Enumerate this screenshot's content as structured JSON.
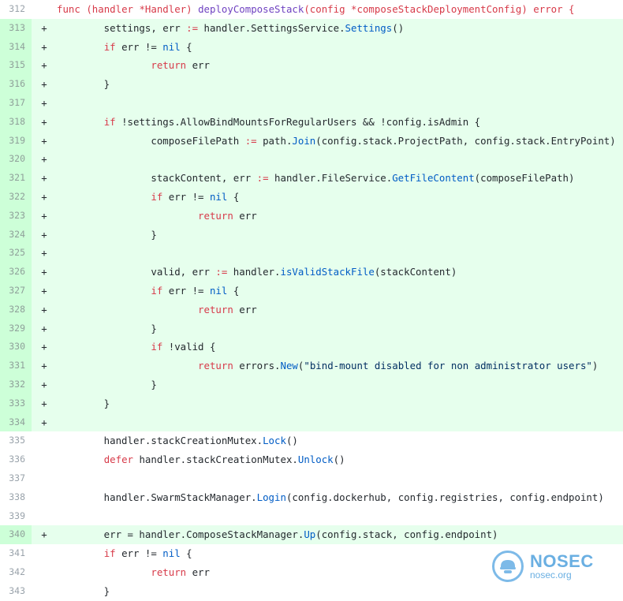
{
  "diff": {
    "lines": [
      {
        "num": "312",
        "type": "context",
        "sign": "",
        "tokens": [
          {
            "t": "kw",
            "v": "func "
          },
          {
            "t": "kw",
            "v": "(handler *Handler) "
          },
          {
            "t": "fn",
            "v": "deployComposeStack"
          },
          {
            "t": "kw",
            "v": "(config *composeStackDeploymentConfig) error {"
          }
        ]
      },
      {
        "num": "313",
        "type": "added",
        "sign": "+",
        "tokens": [
          {
            "t": "plain",
            "v": "        settings, err "
          },
          {
            "t": "kw",
            "v": ":="
          },
          {
            "t": "plain",
            "v": " handler.SettingsService."
          },
          {
            "t": "call",
            "v": "Settings"
          },
          {
            "t": "plain",
            "v": "()"
          }
        ]
      },
      {
        "num": "314",
        "type": "added",
        "sign": "+",
        "tokens": [
          {
            "t": "plain",
            "v": "        "
          },
          {
            "t": "kw",
            "v": "if"
          },
          {
            "t": "plain",
            "v": " err != "
          },
          {
            "t": "call",
            "v": "nil"
          },
          {
            "t": "plain",
            "v": " {"
          }
        ]
      },
      {
        "num": "315",
        "type": "added",
        "sign": "+",
        "tokens": [
          {
            "t": "plain",
            "v": "                "
          },
          {
            "t": "kw",
            "v": "return"
          },
          {
            "t": "plain",
            "v": " err"
          }
        ]
      },
      {
        "num": "316",
        "type": "added",
        "sign": "+",
        "tokens": [
          {
            "t": "plain",
            "v": "        }"
          }
        ]
      },
      {
        "num": "317",
        "type": "added",
        "sign": "+",
        "tokens": []
      },
      {
        "num": "318",
        "type": "added",
        "sign": "+",
        "tokens": [
          {
            "t": "plain",
            "v": "        "
          },
          {
            "t": "kw",
            "v": "if"
          },
          {
            "t": "plain",
            "v": " !settings.AllowBindMountsForRegularUsers && !config.isAdmin {"
          }
        ]
      },
      {
        "num": "319",
        "type": "added",
        "sign": "+",
        "tokens": [
          {
            "t": "plain",
            "v": "                composeFilePath "
          },
          {
            "t": "kw",
            "v": ":="
          },
          {
            "t": "plain",
            "v": " path."
          },
          {
            "t": "call",
            "v": "Join"
          },
          {
            "t": "plain",
            "v": "(config.stack.ProjectPath, config.stack.EntryPoint)"
          }
        ]
      },
      {
        "num": "320",
        "type": "added",
        "sign": "+",
        "tokens": []
      },
      {
        "num": "321",
        "type": "added",
        "sign": "+",
        "tokens": [
          {
            "t": "plain",
            "v": "                stackContent, err "
          },
          {
            "t": "kw",
            "v": ":="
          },
          {
            "t": "plain",
            "v": " handler.FileService."
          },
          {
            "t": "call",
            "v": "GetFileContent"
          },
          {
            "t": "plain",
            "v": "(composeFilePath)"
          }
        ]
      },
      {
        "num": "322",
        "type": "added",
        "sign": "+",
        "tokens": [
          {
            "t": "plain",
            "v": "                "
          },
          {
            "t": "kw",
            "v": "if"
          },
          {
            "t": "plain",
            "v": " err != "
          },
          {
            "t": "call",
            "v": "nil"
          },
          {
            "t": "plain",
            "v": " {"
          }
        ]
      },
      {
        "num": "323",
        "type": "added",
        "sign": "+",
        "tokens": [
          {
            "t": "plain",
            "v": "                        "
          },
          {
            "t": "kw",
            "v": "return"
          },
          {
            "t": "plain",
            "v": " err"
          }
        ]
      },
      {
        "num": "324",
        "type": "added",
        "sign": "+",
        "tokens": [
          {
            "t": "plain",
            "v": "                }"
          }
        ]
      },
      {
        "num": "325",
        "type": "added",
        "sign": "+",
        "tokens": []
      },
      {
        "num": "326",
        "type": "added",
        "sign": "+",
        "tokens": [
          {
            "t": "plain",
            "v": "                valid, err "
          },
          {
            "t": "kw",
            "v": ":="
          },
          {
            "t": "plain",
            "v": " handler."
          },
          {
            "t": "call",
            "v": "isValidStackFile"
          },
          {
            "t": "plain",
            "v": "(stackContent)"
          }
        ]
      },
      {
        "num": "327",
        "type": "added",
        "sign": "+",
        "tokens": [
          {
            "t": "plain",
            "v": "                "
          },
          {
            "t": "kw",
            "v": "if"
          },
          {
            "t": "plain",
            "v": " err != "
          },
          {
            "t": "call",
            "v": "nil"
          },
          {
            "t": "plain",
            "v": " {"
          }
        ]
      },
      {
        "num": "328",
        "type": "added",
        "sign": "+",
        "tokens": [
          {
            "t": "plain",
            "v": "                        "
          },
          {
            "t": "kw",
            "v": "return"
          },
          {
            "t": "plain",
            "v": " err"
          }
        ]
      },
      {
        "num": "329",
        "type": "added",
        "sign": "+",
        "tokens": [
          {
            "t": "plain",
            "v": "                }"
          }
        ]
      },
      {
        "num": "330",
        "type": "added",
        "sign": "+",
        "tokens": [
          {
            "t": "plain",
            "v": "                "
          },
          {
            "t": "kw",
            "v": "if"
          },
          {
            "t": "plain",
            "v": " !valid {"
          }
        ]
      },
      {
        "num": "331",
        "type": "added",
        "sign": "+",
        "tokens": [
          {
            "t": "plain",
            "v": "                        "
          },
          {
            "t": "kw",
            "v": "return"
          },
          {
            "t": "plain",
            "v": " errors."
          },
          {
            "t": "call",
            "v": "New"
          },
          {
            "t": "plain",
            "v": "("
          },
          {
            "t": "str",
            "v": "\"bind-mount disabled for non administrator users\""
          },
          {
            "t": "plain",
            "v": ")"
          }
        ]
      },
      {
        "num": "332",
        "type": "added",
        "sign": "+",
        "tokens": [
          {
            "t": "plain",
            "v": "                }"
          }
        ]
      },
      {
        "num": "333",
        "type": "added",
        "sign": "+",
        "tokens": [
          {
            "t": "plain",
            "v": "        }"
          }
        ]
      },
      {
        "num": "334",
        "type": "added",
        "sign": "+",
        "tokens": []
      },
      {
        "num": "335",
        "type": "context",
        "sign": "",
        "tokens": [
          {
            "t": "plain",
            "v": "        handler.stackCreationMutex."
          },
          {
            "t": "call",
            "v": "Lock"
          },
          {
            "t": "plain",
            "v": "()"
          }
        ]
      },
      {
        "num": "336",
        "type": "context",
        "sign": "",
        "tokens": [
          {
            "t": "plain",
            "v": "        "
          },
          {
            "t": "kw",
            "v": "defer"
          },
          {
            "t": "plain",
            "v": " handler.stackCreationMutex."
          },
          {
            "t": "call",
            "v": "Unlock"
          },
          {
            "t": "plain",
            "v": "()"
          }
        ]
      },
      {
        "num": "337",
        "type": "context",
        "sign": "",
        "tokens": []
      },
      {
        "num": "338",
        "type": "context",
        "sign": "",
        "tokens": [
          {
            "t": "plain",
            "v": "        handler.SwarmStackManager."
          },
          {
            "t": "call",
            "v": "Login"
          },
          {
            "t": "plain",
            "v": "(config.dockerhub, config.registries, config.endpoint)"
          }
        ]
      },
      {
        "num": "339",
        "type": "context",
        "sign": "",
        "tokens": []
      },
      {
        "num": "340",
        "type": "added",
        "sign": "+",
        "tokens": [
          {
            "t": "plain",
            "v": "        err = handler.ComposeStackManager."
          },
          {
            "t": "call",
            "v": "Up"
          },
          {
            "t": "plain",
            "v": "(config.stack, config.endpoint)"
          }
        ]
      },
      {
        "num": "341",
        "type": "context",
        "sign": "",
        "tokens": [
          {
            "t": "plain",
            "v": "        "
          },
          {
            "t": "kw",
            "v": "if"
          },
          {
            "t": "plain",
            "v": " err != "
          },
          {
            "t": "call",
            "v": "nil"
          },
          {
            "t": "plain",
            "v": " {"
          }
        ]
      },
      {
        "num": "342",
        "type": "context",
        "sign": "",
        "tokens": [
          {
            "t": "plain",
            "v": "                "
          },
          {
            "t": "kw",
            "v": "return"
          },
          {
            "t": "plain",
            "v": " err"
          }
        ]
      },
      {
        "num": "343",
        "type": "context",
        "sign": "",
        "tokens": [
          {
            "t": "plain",
            "v": "        }"
          }
        ]
      }
    ]
  },
  "watermark": {
    "brand": "NOSEC",
    "domain": "nosec.org",
    "icon": "helmet-shield-icon",
    "color": "#5aa7df"
  },
  "colors": {
    "added_bg": "#e6ffed",
    "added_gutter": "#cdffd8",
    "keyword": "#d73a49",
    "function": "#6f42c1",
    "call": "#005cc5",
    "string": "#032f62"
  }
}
